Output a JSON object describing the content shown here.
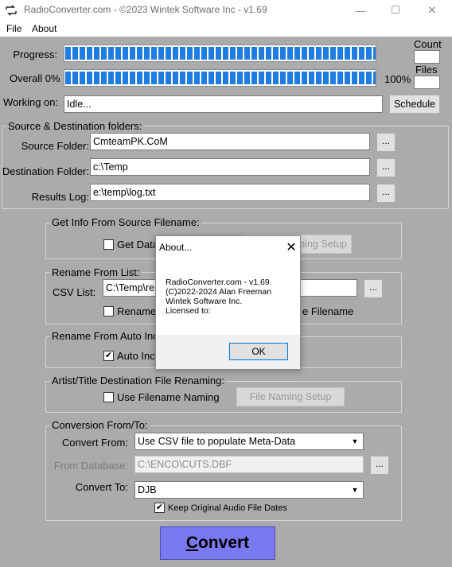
{
  "window": {
    "title": "RadioConverter.com - ©2023 Wintek Software Inc - v1.69",
    "minimize": "—",
    "maximize": "☐",
    "close": "✕"
  },
  "menu": [
    "File",
    "About"
  ],
  "progress": {
    "progress_label": "Progress:",
    "overall_label": "Overall 0%",
    "overall_right": "100%",
    "count_label": "Count",
    "files_label": "Files",
    "count_value": "",
    "files_value": "",
    "working_label": "Working on:",
    "working_value": "Idle...",
    "schedule_button": "Schedule"
  },
  "folders": {
    "title": "Source & Destination folders:",
    "source_label": "Source Folder:",
    "source_value": "CmteamPK.CoM",
    "dest_label": "Destination Folder:",
    "dest_value": "c:\\Temp",
    "log_label": "Results Log:",
    "log_value": "e:\\temp\\log.txt",
    "browse": "..."
  },
  "info_group": {
    "title": "Get Info From Source Filename:",
    "checkbox_label": "Get Data",
    "checked": false,
    "button": "Naming Setup"
  },
  "rename_list": {
    "title": "Rename From List:",
    "csv_label": "CSV List:",
    "csv_value": "C:\\Temp\\re",
    "browse": "...",
    "checkbox_label": "Rename",
    "checked": false,
    "right_text": "e Filename"
  },
  "rename_auto": {
    "title": "Rename From Auto Inc",
    "checkbox_label": "Auto Inc",
    "checked": true
  },
  "artist_title": {
    "title": "Artist/Title Destination File Renaming:",
    "checkbox_label": "Use Filename Naming",
    "checked": false,
    "button": "File Naming Setup"
  },
  "conversion": {
    "title": "Conversion From/To:",
    "from_label": "Convert From:",
    "from_value": "Use CSV file to populate Meta-Data",
    "db_label": "From Database:",
    "db_value": "C:\\ENCO\\CUTS.DBF",
    "browse": "...",
    "to_label": "Convert To:",
    "to_value": "DJB",
    "keep_label": "Keep Original Audio File Dates",
    "keep_checked": true
  },
  "convert_button": "Convert",
  "about_dialog": {
    "title": "About...",
    "body": "RadioConverter.com - v1.69\n(C)2022-2024 Alan Freeman\nWintek Software Inc.\nLicensed to:",
    "ok": "OK",
    "close": "✕"
  },
  "colors": {
    "progress_fill": "#1f7ce0",
    "client_bg": "#ababab",
    "convert_bg": "#7b79f0"
  }
}
